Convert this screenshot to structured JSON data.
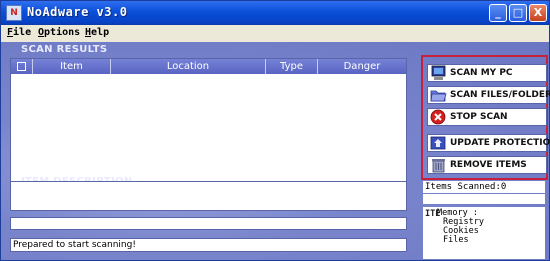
{
  "window": {
    "title": "NoAdware v3.0",
    "icon_text": "N",
    "controls": {
      "minimize": "_",
      "maximize": "□",
      "close": "X"
    }
  },
  "menu": [
    {
      "underline": "F",
      "rest": "ile"
    },
    {
      "underline": "O",
      "rest": "ptions"
    },
    {
      "underline": "H",
      "rest": "elp"
    }
  ],
  "scan_results": {
    "label": "SCAN RESULTS",
    "columns": [
      "Item",
      "Location",
      "Type",
      "Danger"
    ],
    "rows": []
  },
  "item_description": {
    "label": "ITEM DESCRIPTION"
  },
  "status": {
    "text": "Prepared to start scanning!"
  },
  "buttons": {
    "scan_my_pc": "SCAN MY PC",
    "scan_files": "SCAN FILES/FOLDERS",
    "stop_scan": "STOP SCAN",
    "update_protection": "UPDATE PROTECTION",
    "remove_items": "REMOVE ITEMS"
  },
  "right_panel": {
    "items_scanned": "Items Scanned:0",
    "tree_prefix": "ITE",
    "tree": [
      "Memory :",
      "Registry",
      "Cookies",
      "Files"
    ]
  },
  "colors": {
    "title_bar": "#0a4fd8",
    "panel_background": "#7985cb",
    "button_highlight_border": "#c6203b",
    "stop_icon": "#d62020"
  }
}
